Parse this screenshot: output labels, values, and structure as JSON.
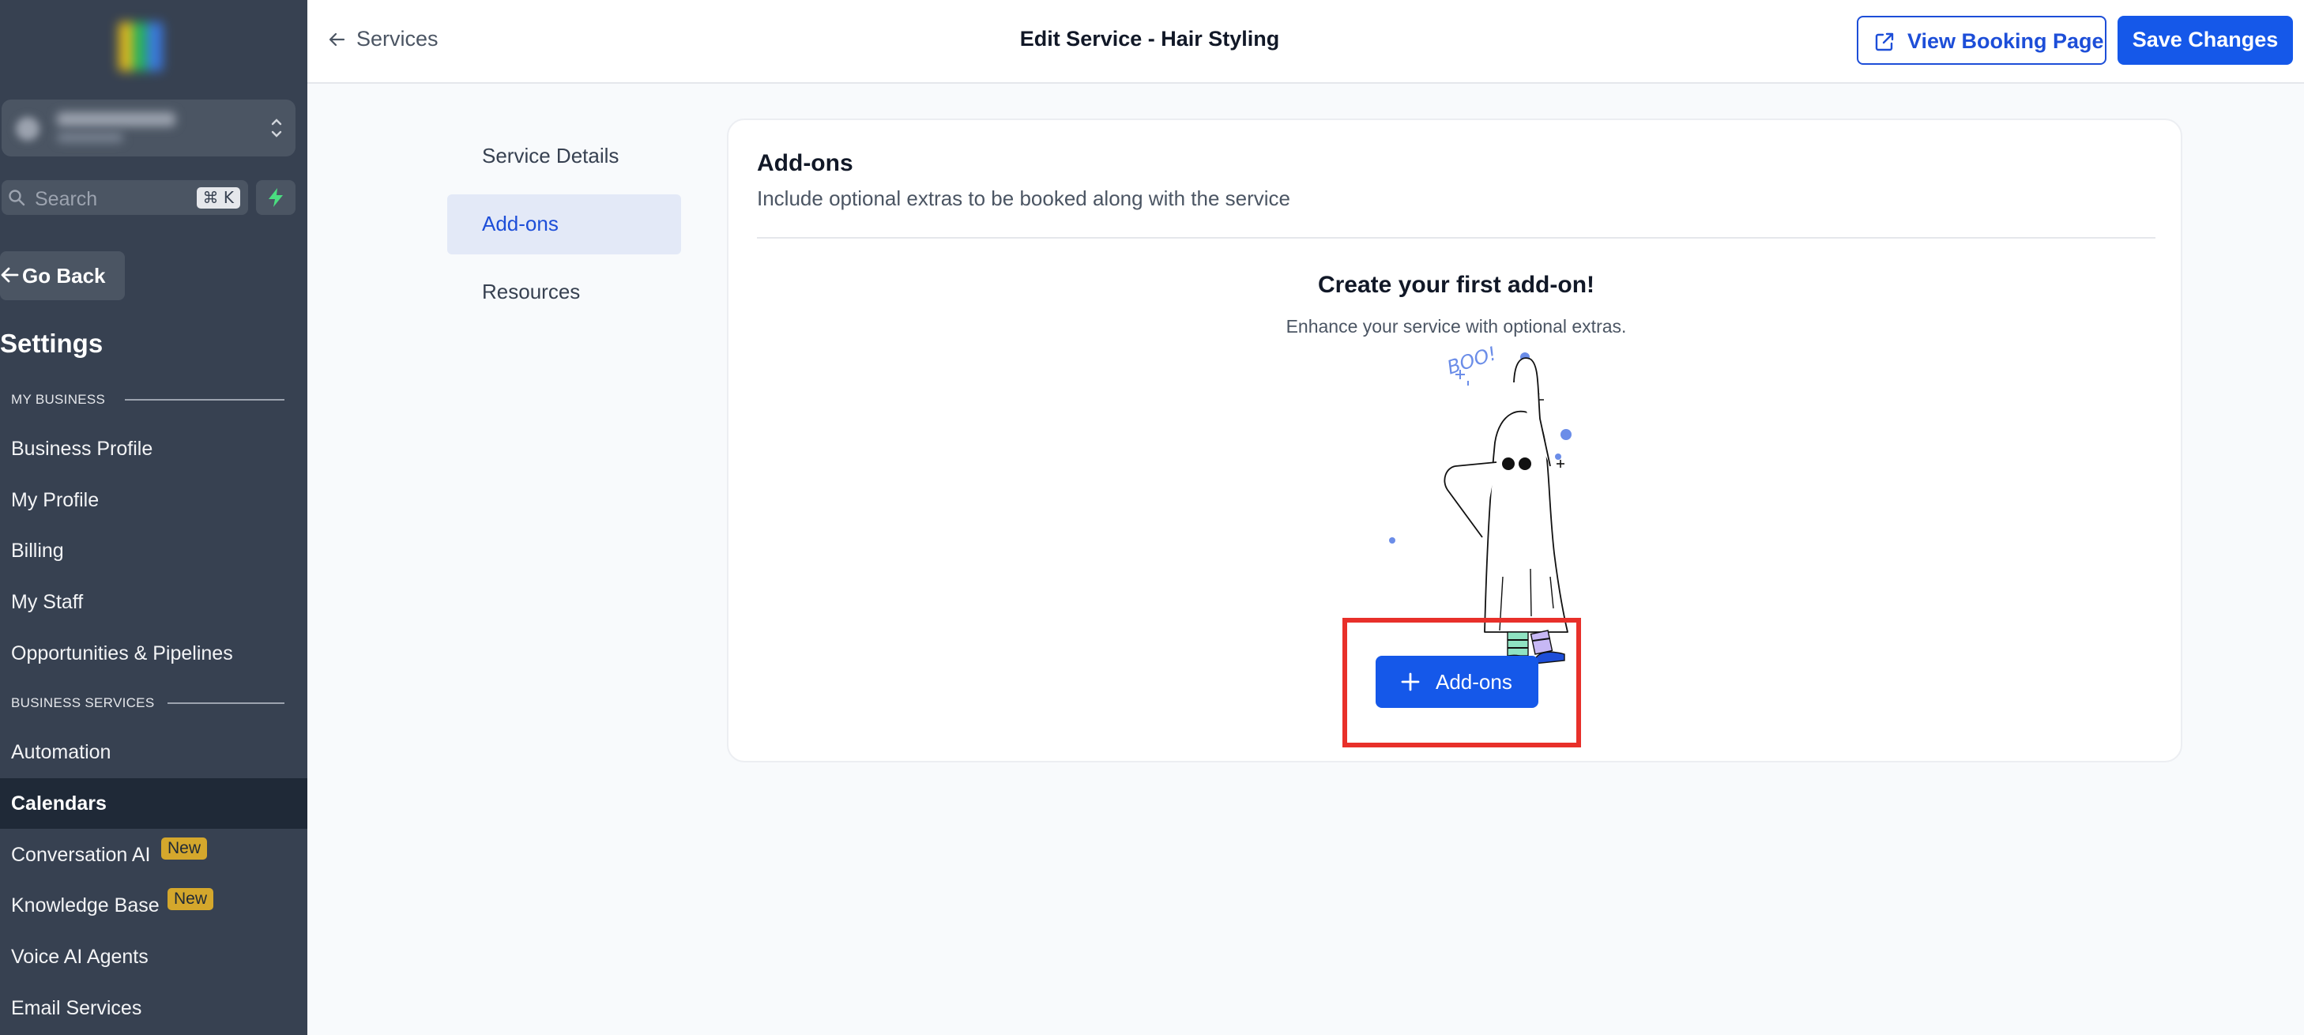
{
  "colors": {
    "sidebar_bg": "#374151",
    "sidebar_active_bg": "#1f2937",
    "primary": "#1558e9",
    "tab_active_bg": "#e3e9f7",
    "badge_bg": "#d4a72c",
    "highlight": "#e8302a",
    "bolt_green": "#4ade80"
  },
  "sidebar": {
    "search": {
      "placeholder": "Search",
      "shortcut": "⌘ K"
    },
    "go_back_label": "Go Back",
    "title": "Settings",
    "sections": [
      {
        "label": "MY BUSINESS",
        "items": [
          {
            "label": "Business Profile"
          },
          {
            "label": "My Profile"
          },
          {
            "label": "Billing"
          },
          {
            "label": "My Staff"
          },
          {
            "label": "Opportunities & Pipelines"
          }
        ]
      },
      {
        "label": "BUSINESS SERVICES",
        "items": [
          {
            "label": "Automation"
          },
          {
            "label": "Calendars",
            "active": true
          },
          {
            "label": "Conversation AI",
            "badge": "New"
          },
          {
            "label": "Knowledge Base",
            "badge": "New"
          },
          {
            "label": "Voice AI Agents"
          },
          {
            "label": "Email Services"
          }
        ]
      }
    ]
  },
  "header": {
    "breadcrumb": "Services",
    "title": "Edit Service - Hair Styling",
    "view_booking_label": "View Booking Page",
    "save_label": "Save Changes"
  },
  "tabs": [
    {
      "label": "Service Details"
    },
    {
      "label": "Add-ons",
      "active": true
    },
    {
      "label": "Resources"
    }
  ],
  "card": {
    "title": "Add-ons",
    "subtitle": "Include optional extras to be booked along with the service",
    "empty_title": "Create your first add-on!",
    "empty_subtitle": "Enhance your service with optional extras.",
    "illustration_text": "BOO!",
    "add_button_label": "Add-ons"
  }
}
